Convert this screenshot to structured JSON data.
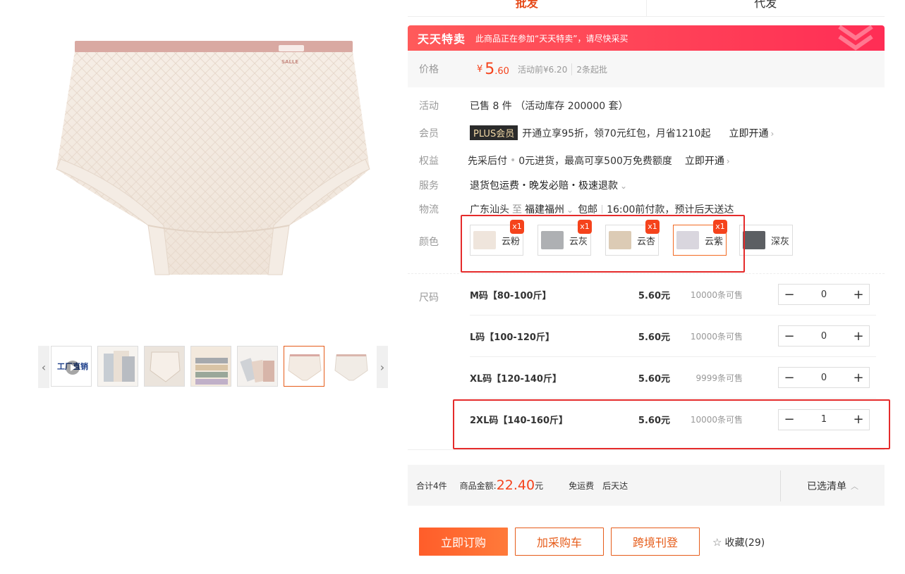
{
  "tabs": [
    {
      "label": "批发"
    },
    {
      "label": "代发"
    }
  ],
  "promo": {
    "logo": "天天特卖",
    "text": "此商品正在参加“天天特卖”，请尽快采买"
  },
  "price": {
    "label": "价格",
    "symbol": "¥",
    "integer": "5",
    "decimal": ".60",
    "original": "活动前¥6.20",
    "min_order": "2条起批"
  },
  "activity": {
    "label": "活动",
    "text": "已售 8 件 （活动库存 200000 套）"
  },
  "member": {
    "label": "会员",
    "tag": "PLUS会员",
    "text": "开通立享95折，领70元红包，月省1210起",
    "link": "立即开通"
  },
  "benefit": {
    "label": "权益",
    "title": "先采后付",
    "desc": "0元进货，最高可享500万免费额度",
    "link": "立即开通"
  },
  "service": {
    "label": "服务",
    "text": "退货包运费・晚发必赔・极速退款"
  },
  "logistics": {
    "label": "物流",
    "from": "广东汕头",
    "to_word": "至",
    "to": "福建福州",
    "free": "包邮",
    "time": "16:00前付款，预计后天送达"
  },
  "colors": {
    "label": "颜色",
    "options": [
      {
        "name": "云粉",
        "badge": "x1",
        "swatch": "#efe5dc"
      },
      {
        "name": "云灰",
        "badge": "x1",
        "swatch": "#aeb0b3"
      },
      {
        "name": "云杏",
        "badge": "x1",
        "swatch": "#dccbb5"
      },
      {
        "name": "云紫",
        "badge": "x1",
        "swatch": "#d9d6de"
      },
      {
        "name": "深灰",
        "badge": "",
        "swatch": "#5c5f63"
      }
    ]
  },
  "sizes": {
    "label": "尺码",
    "rows": [
      {
        "name": "M码【80-100斤】",
        "price": "5.60元",
        "stock": "10000条可售",
        "qty": "0"
      },
      {
        "name": "L码【100-120斤】",
        "price": "5.60元",
        "stock": "10000条可售",
        "qty": "0"
      },
      {
        "name": "XL码【120-140斤】",
        "price": "5.60元",
        "stock": "9999条可售",
        "qty": "0"
      },
      {
        "name": "2XL码【140-160斤】",
        "price": "5.60元",
        "stock": "10000条可售",
        "qty": "1"
      }
    ]
  },
  "summary": {
    "count": "合计4件",
    "amount_label": "商品金额:",
    "amount": "22.40",
    "yuan": "元",
    "shipping": "免运费",
    "arrival": "后天达",
    "list_label": "已选清单"
  },
  "actions": {
    "order": "立即订购",
    "cart": "加采购车",
    "cross": "跨境刊登",
    "fav": "收藏(29)"
  },
  "thumbs": {
    "video_text": "工厂直销"
  },
  "brand_mark": "SALLE"
}
